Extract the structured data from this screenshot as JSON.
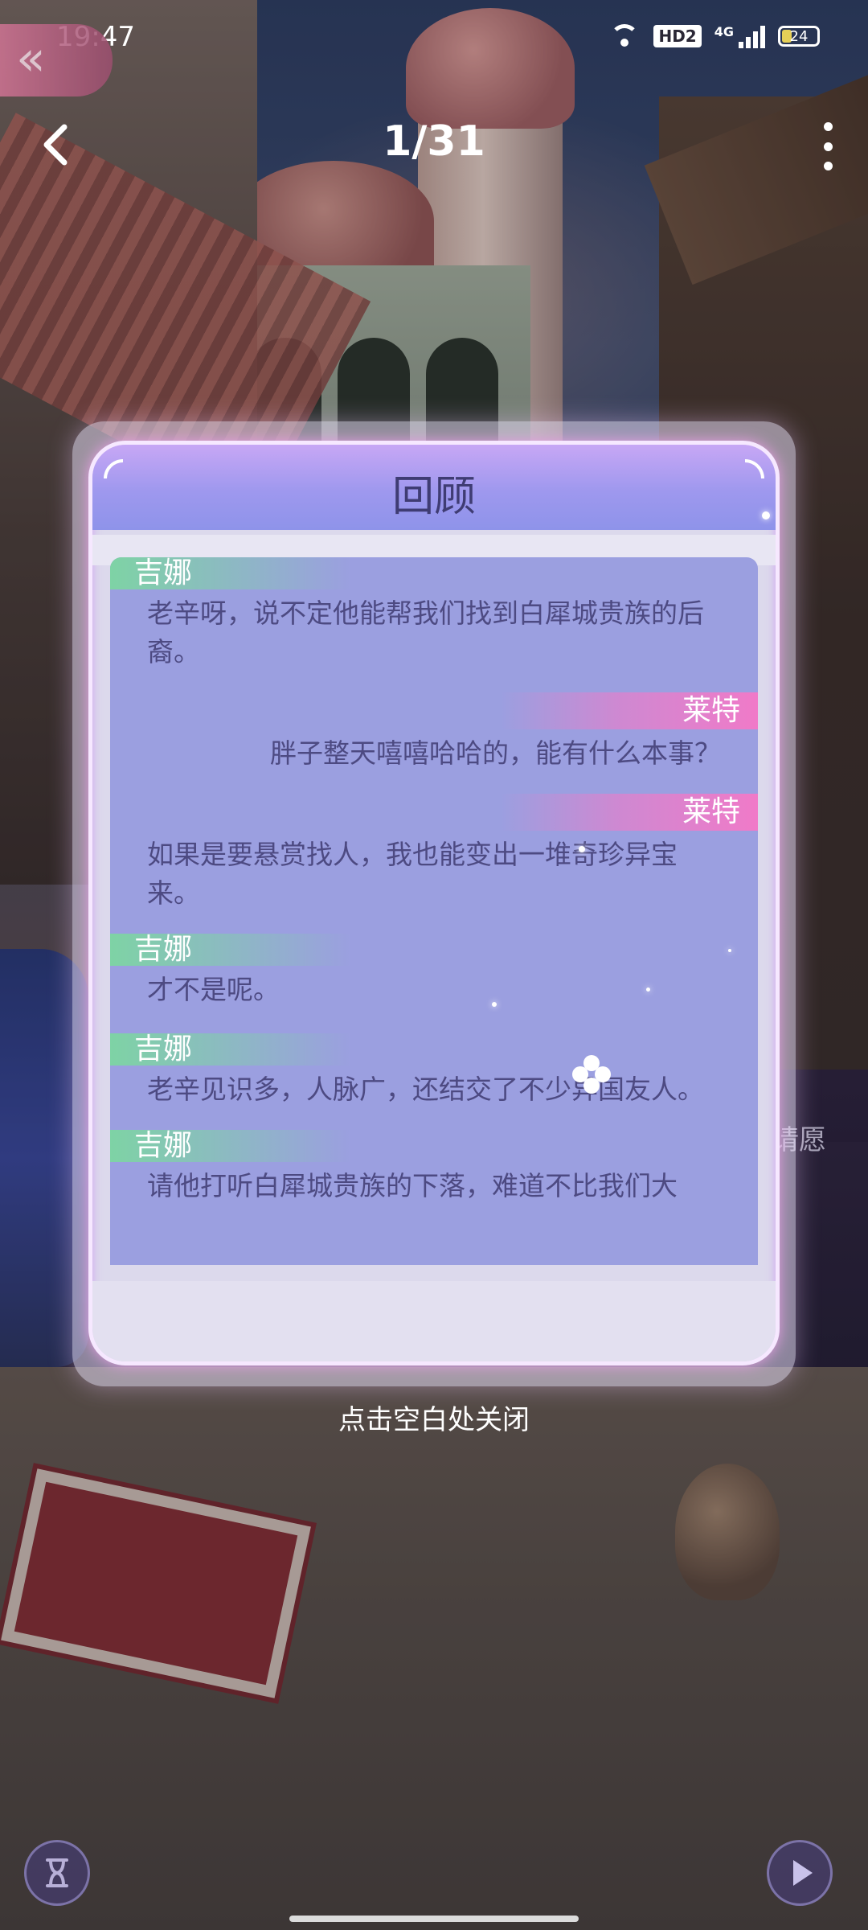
{
  "status_bar": {
    "time": "19:47",
    "hd_label": "HD2",
    "network": "4G",
    "battery": "24"
  },
  "nav": {
    "page_counter": "1/31"
  },
  "dialog": {
    "title": "回顾",
    "entries": [
      {
        "speaker": "吉娜",
        "side": "left",
        "text": "老辛呀，说不定他能帮我们找到白犀城贵族的后裔。"
      },
      {
        "speaker": "莱特",
        "side": "right",
        "text": "胖子整天嘻嘻哈哈的，能有什么本事？"
      },
      {
        "speaker": "莱特",
        "side": "right",
        "text": "如果是要悬赏找人，我也能变出一堆奇珍异宝来。"
      },
      {
        "speaker": "吉娜",
        "side": "left",
        "text": "才不是呢。"
      },
      {
        "speaker": "吉娜",
        "side": "left",
        "text": "老辛见识多，人脉广，还结交了不少异国友人。"
      },
      {
        "speaker": "吉娜",
        "side": "left",
        "text": "请他打听白犀城贵族的下落，难道不比我们大"
      }
    ]
  },
  "close_hint": "点击空白处关闭",
  "background": {
    "wish_label": "请愿"
  },
  "icons": {
    "back": "chevron-left-icon",
    "more": "more-vertical-icon",
    "skip": "rewind-icon",
    "hourglass": "hourglass-icon",
    "play": "play-icon"
  },
  "colors": {
    "list_bg": "#9b9fe0",
    "speaker_left": "#7ed3a5",
    "speaker_right": "#f07ac8",
    "text": "#4d4a82"
  }
}
